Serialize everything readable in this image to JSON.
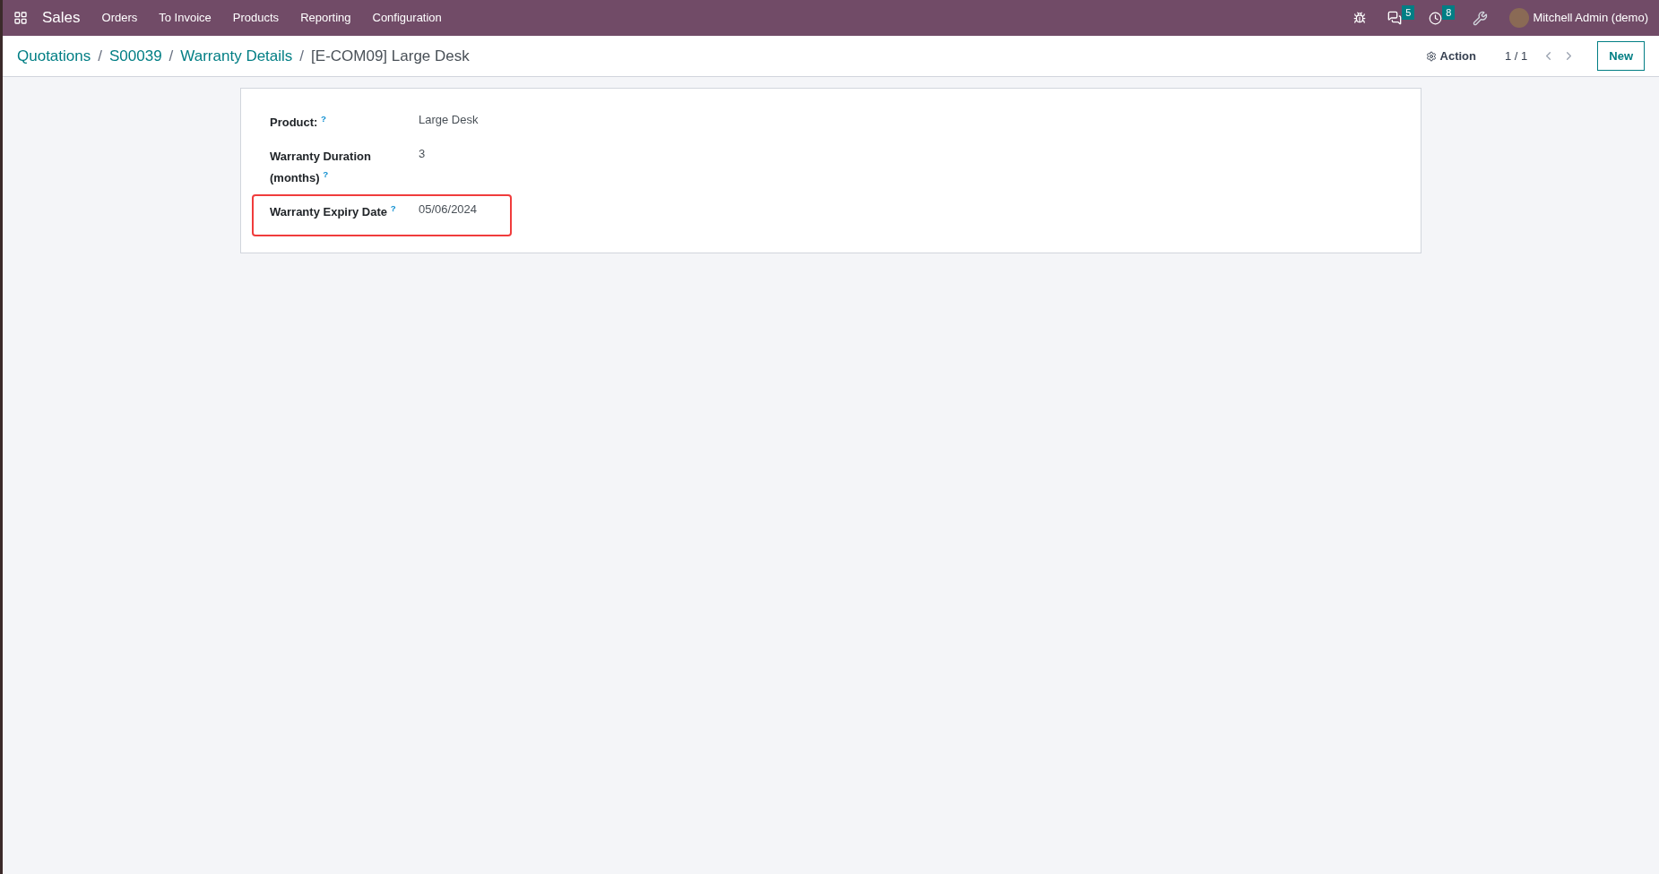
{
  "navbar": {
    "app": "Sales",
    "menu": [
      "Orders",
      "To Invoice",
      "Products",
      "Reporting",
      "Configuration"
    ],
    "messages_count": "5",
    "activities_count": "8",
    "user": "Mitchell Admin (demo)"
  },
  "breadcrumbs": [
    {
      "label": "Quotations",
      "kind": "link"
    },
    {
      "separator": "/",
      "label": "S00039",
      "kind": "link"
    },
    {
      "separator": "/",
      "label": "Warranty Details",
      "kind": "link"
    },
    {
      "separator": "/",
      "label": "[E-COM09] Large Desk",
      "kind": "current"
    }
  ],
  "control_panel": {
    "action": "Action",
    "pager": "1 / 1",
    "new_button": "New"
  },
  "fields": [
    {
      "label": "Product: $^{?}$",
      "value": "Large Desk",
      "highlighted": false
    },
    {
      "label": "Warranty Duration (months) $^{?}$",
      "value": "3",
      "highlighted": false
    },
    {
      "label": "Warranty Expiry Date $^{?}$",
      "value": "05/06/2024",
      "highlighted": true
    }
  ]
}
